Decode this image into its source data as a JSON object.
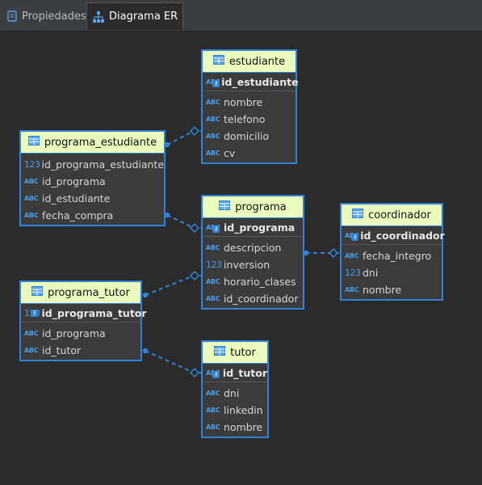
{
  "tabs": [
    {
      "label": "Propiedades",
      "icon": "properties-icon",
      "active": false
    },
    {
      "label": "Diagrama ER",
      "icon": "er-diagram-icon",
      "active": true
    }
  ],
  "entities": {
    "estudiante": {
      "name": "estudiante",
      "pk": {
        "type": "ABC",
        "name": "id_estudiante"
      },
      "columns": [
        {
          "type": "ABC",
          "name": "nombre"
        },
        {
          "type": "ABC",
          "name": "telefono"
        },
        {
          "type": "ABC",
          "name": "domicilio"
        },
        {
          "type": "ABC",
          "name": "cv"
        }
      ]
    },
    "programa_estudiante": {
      "name": "programa_estudiante",
      "pk": null,
      "columns": [
        {
          "type": "123",
          "name": "id_programa_estudiante"
        },
        {
          "type": "ABC",
          "name": "id_programa"
        },
        {
          "type": "ABC",
          "name": "id_estudiante"
        },
        {
          "type": "ABC",
          "name": "fecha_compra"
        }
      ]
    },
    "programa": {
      "name": "programa",
      "pk": {
        "type": "ABC",
        "name": "id_programa"
      },
      "columns": [
        {
          "type": "ABC",
          "name": "descripcion"
        },
        {
          "type": "123",
          "name": "inversion"
        },
        {
          "type": "ABC",
          "name": "horario_clases"
        },
        {
          "type": "ABC",
          "name": "id_coordinador"
        }
      ]
    },
    "coordinador": {
      "name": "coordinador",
      "pk": {
        "type": "ABC",
        "name": "id_coordinador"
      },
      "columns": [
        {
          "type": "ABC",
          "name": "fecha_integro"
        },
        {
          "type": "123",
          "name": "dni"
        },
        {
          "type": "ABC",
          "name": "nombre"
        }
      ]
    },
    "programa_tutor": {
      "name": "programa_tutor",
      "pk": {
        "type": "123",
        "name": "id_programa_tutor"
      },
      "columns": [
        {
          "type": "ABC",
          "name": "id_programa"
        },
        {
          "type": "ABC",
          "name": "id_tutor"
        }
      ]
    },
    "tutor": {
      "name": "tutor",
      "pk": {
        "type": "ABC",
        "name": "id_tutor"
      },
      "columns": [
        {
          "type": "ABC",
          "name": "dni"
        },
        {
          "type": "ABC",
          "name": "linkedin"
        },
        {
          "type": "ABC",
          "name": "nombre"
        }
      ]
    }
  },
  "relations": [
    {
      "from": "programa_estudiante",
      "to": "estudiante"
    },
    {
      "from": "programa_estudiante",
      "to": "programa"
    },
    {
      "from": "programa",
      "to": "coordinador"
    },
    {
      "from": "programa_tutor",
      "to": "programa"
    },
    {
      "from": "programa_tutor",
      "to": "tutor"
    }
  ],
  "colors": {
    "background": "#2b2b2b",
    "entity_border": "#2f82d6",
    "header": "#e9fcbe",
    "relation": "#2f82d6",
    "type_text": "#4a9de8"
  }
}
